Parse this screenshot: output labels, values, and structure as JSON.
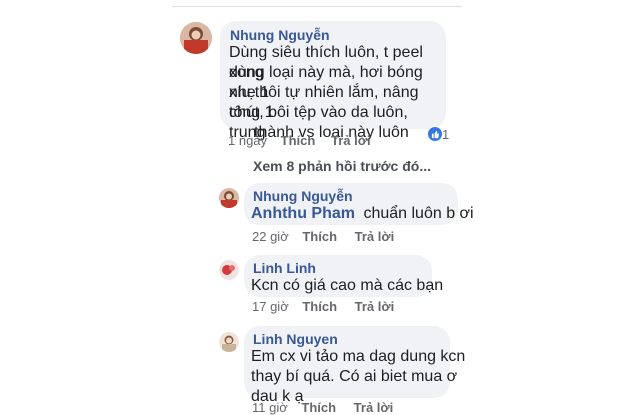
{
  "comments": [
    {
      "author": "Nhung Nguyễn",
      "lines": [
        "Dùng siêu thích luôn, t peel xong",
        "dùng loại này mà, hơi bóng nhẹ 1",
        "xíu thôi tự nhiên lắm, nâng tông 1",
        "chút, bôi tệp vào da luôn, trung",
        "thành vs loại này luôn"
      ],
      "time": "1 ngày",
      "like": "Thích",
      "reply": "Trả lời",
      "reaction_count": "1"
    }
  ],
  "view_more": "Xem 8 phản hồi trước đó...",
  "replies": [
    {
      "author": "Nhung Nguyễn",
      "tag": "Anhthu Pham",
      "text": "chuẩn luôn b ơi",
      "time": "22 giờ",
      "like": "Thích",
      "reply": "Trả lời"
    },
    {
      "author": "Linh Linh",
      "text": "Kcn có giá cao mà các bạn",
      "time": "17 giờ",
      "like": "Thích",
      "reply": "Trả lời"
    },
    {
      "author": "Linh Nguyen",
      "lines": [
        "Em cx vi tảo ma dag dung kcn",
        "thay bí quá. Có ai biet mua ơ",
        "dau k ạ"
      ],
      "time": "11 giờ",
      "like": "Thích",
      "reply": "Trả lời"
    }
  ],
  "colors": {
    "bubble": "#f0f2f5",
    "link": "#385898",
    "meta": "#65676b",
    "like_reaction": "#3578e5"
  }
}
